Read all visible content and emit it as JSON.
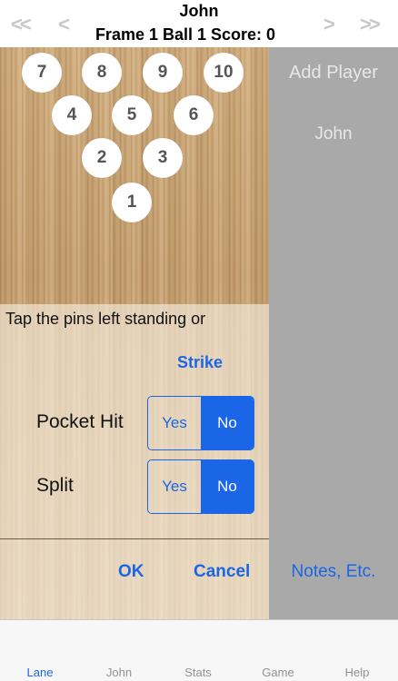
{
  "header": {
    "player_name": "John",
    "frame_info": "Frame 1 Ball 1 Score: 0",
    "nav_first": "<<",
    "nav_prev": "<",
    "nav_next": ">",
    "nav_last": ">>"
  },
  "pins": [
    "7",
    "8",
    "9",
    "10",
    "4",
    "5",
    "6",
    "2",
    "3",
    "1"
  ],
  "panel": {
    "instructions": "Tap the pins left standing or",
    "strike_label": "Strike",
    "pocket_hit": {
      "label": "Pocket Hit",
      "yes": "Yes",
      "no": "No",
      "selected": "No"
    },
    "split": {
      "label": "Split",
      "yes": "Yes",
      "no": "No",
      "selected": "No"
    },
    "ok_label": "OK",
    "cancel_label": "Cancel"
  },
  "sidebar": {
    "add_player": "Add Player",
    "player": "John",
    "notes": "Notes, Etc."
  },
  "tabs": [
    {
      "label": "Lane",
      "active": true
    },
    {
      "label": "John",
      "active": false
    },
    {
      "label": "Stats",
      "active": false
    },
    {
      "label": "Game",
      "active": false
    },
    {
      "label": "Help",
      "active": false
    }
  ],
  "colors": {
    "accent": "#1a66e6",
    "sidebar_bg": "#a9a9a9",
    "tabbar_bg": "#f7f7f7"
  }
}
